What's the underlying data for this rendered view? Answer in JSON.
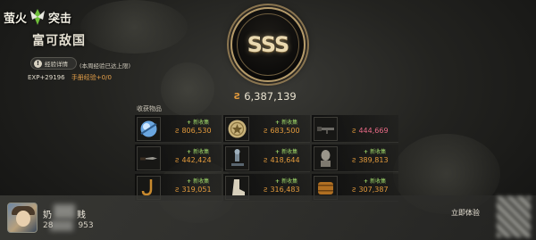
{
  "header": {
    "logo_text_left": "萤火",
    "logo_text_right": "突击",
    "title": "富可敌国",
    "xp_details_label": "经验详情",
    "xp_weekly_note": "(本周经验已达上限)",
    "exp_text": "EXP+29196",
    "handbook_text": "手册经验+0/0"
  },
  "result": {
    "rank": "SSS",
    "total_value": "6,387,139"
  },
  "loot": {
    "label": "收获物品",
    "new_label": "新收集",
    "items": [
      {
        "icon": "blue-orb-icon",
        "value": "806,530",
        "is_new": true,
        "color": "#e39a3c"
      },
      {
        "icon": "gold-medal-icon",
        "value": "683,500",
        "is_new": true,
        "color": "#e39a3c"
      },
      {
        "icon": "rifle-icon",
        "value": "444,669",
        "is_new": false,
        "color": "#e86a86"
      },
      {
        "icon": "knife-icon",
        "value": "442,424",
        "is_new": true,
        "color": "#e39a3c"
      },
      {
        "icon": "microscope-icon",
        "value": "418,644",
        "is_new": true,
        "color": "#e39a3c"
      },
      {
        "icon": "bust-statue-icon",
        "value": "389,813",
        "is_new": true,
        "color": "#e39a3c"
      },
      {
        "icon": "hook-icon",
        "value": "319,051",
        "is_new": true,
        "color": "#e39a3c"
      },
      {
        "icon": "boot-icon",
        "value": "316,483",
        "is_new": true,
        "color": "#e39a3c"
      },
      {
        "icon": "barrel-icon",
        "value": "307,387",
        "is_new": true,
        "color": "#e39a3c"
      }
    ]
  },
  "player": {
    "name": "奶",
    "name_suffix": "贱",
    "id_prefix": "28",
    "id_suffix": "953"
  },
  "actions": {
    "experience_now": "立即体验"
  }
}
